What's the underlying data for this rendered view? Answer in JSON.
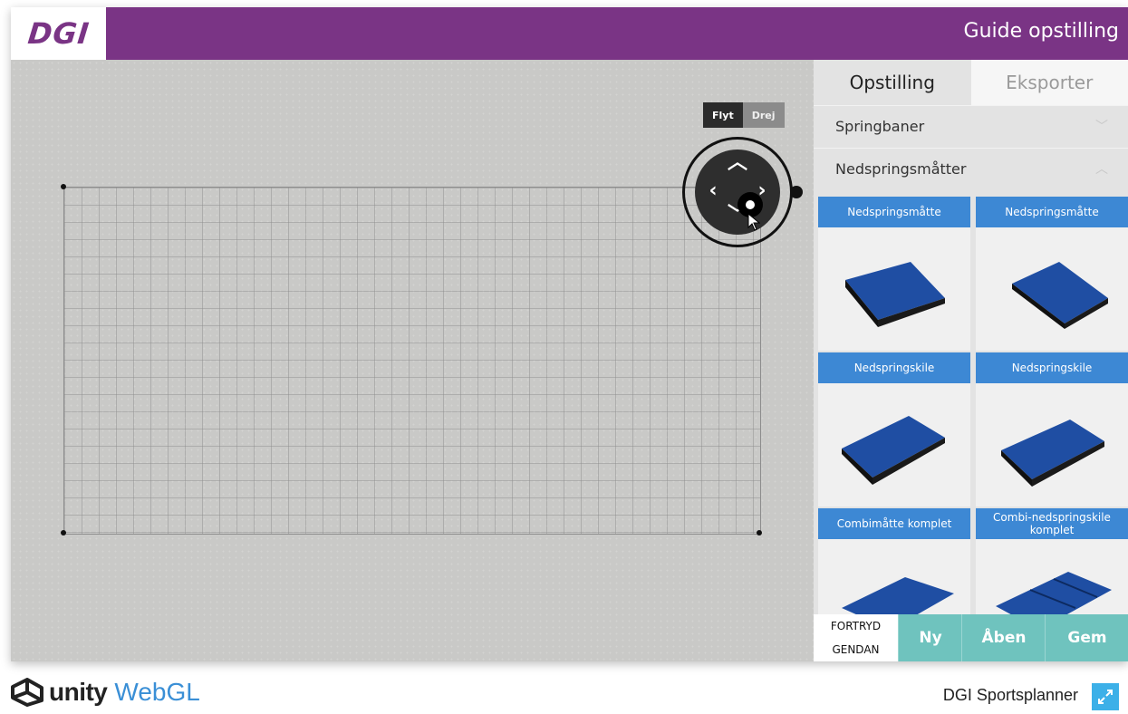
{
  "header": {
    "logo_text": "DGI",
    "title": "Guide opstilling"
  },
  "mode_toggle": {
    "options": [
      "Flyt",
      "Drej"
    ],
    "selected": "Flyt"
  },
  "sidepanel": {
    "tabs": [
      {
        "label": "Opstilling",
        "active": true
      },
      {
        "label": "Eksporter",
        "active": false
      }
    ],
    "sections": [
      {
        "label": "Springbaner",
        "expanded": false
      },
      {
        "label": "Nedspringsmåtter",
        "expanded": true
      }
    ],
    "items": [
      {
        "label": "Nedspringsmåtte"
      },
      {
        "label": "Nedspringsmåtte"
      },
      {
        "label": "Nedspringskile"
      },
      {
        "label": "Nedspringskile"
      },
      {
        "label": "Combimåtte komplet"
      },
      {
        "label": "Combi-nedspringskile komplet"
      }
    ]
  },
  "actions": {
    "undo": "FORTRYD",
    "redo": "GENDAN",
    "new": "Ny",
    "open": "Åben",
    "save": "Gem"
  },
  "footer": {
    "unity_text": "unity",
    "webgl_text": "WebGL",
    "product_name": "DGI Sportsplanner"
  },
  "colors": {
    "brand_purple": "#7a3485",
    "item_header_blue": "#3d88d4",
    "action_teal": "#6fc3be",
    "mat_blue": "#1f4ea3"
  },
  "icons": {
    "joystick": "move-joystick-icon",
    "fullscreen": "fullscreen-icon",
    "chevron_down": "chevron-down-icon",
    "chevron_up": "chevron-up-icon"
  }
}
